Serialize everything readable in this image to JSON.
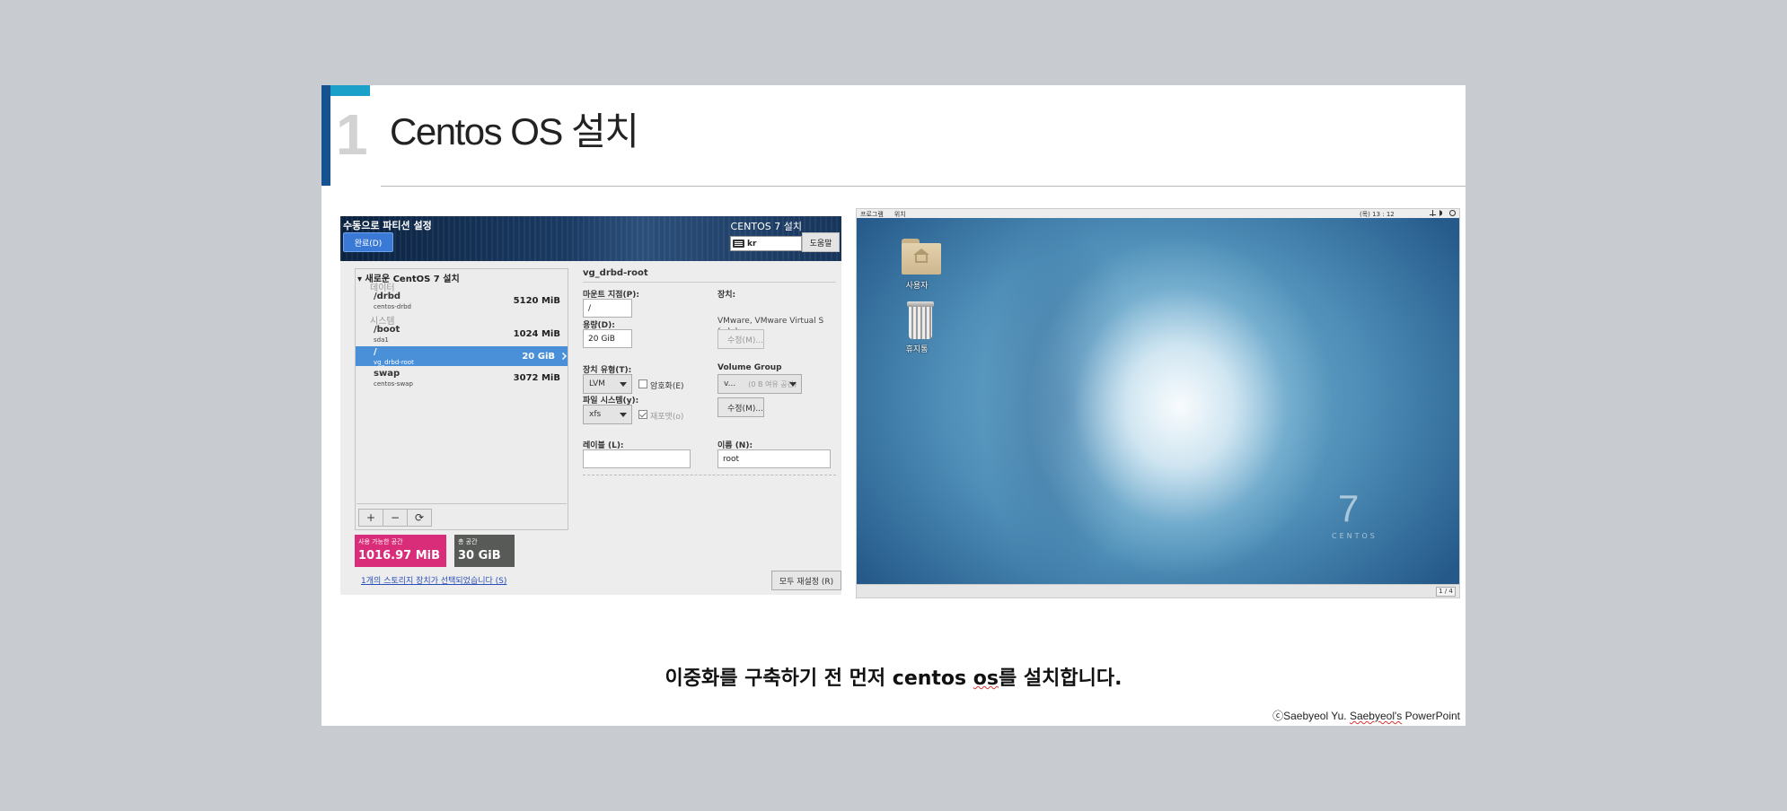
{
  "slide": {
    "number": "1",
    "title": "Centos  OS 설치",
    "caption_before": "이중화를 구축하기 전 먼저 centos ",
    "caption_os": "os",
    "caption_after": "를 설치합니다.",
    "credit_before": "ⓒSaebyeol Yu.  ",
    "credit_name": "Saebyeol's",
    "credit_after": " PowerPoint"
  },
  "partition": {
    "title": "수동으로 파티션 설정",
    "done_label": "완료(D)",
    "product": "CENTOS 7 설치",
    "keyboard": "kr",
    "help_label": "도움말",
    "tree_header": "새로운 CentOS 7 설치",
    "groups": [
      "데이터",
      "시스템"
    ],
    "items": [
      {
        "name": "/drbd",
        "device": "centos-drbd",
        "size": "5120 MiB"
      },
      {
        "name": "/boot",
        "device": "sda1",
        "size": "1024 MiB"
      },
      {
        "name": "/",
        "device": "vg_drbd-root",
        "size": "20 GiB"
      },
      {
        "name": "swap",
        "device": "centos-swap",
        "size": "3072 MiB"
      }
    ],
    "tools": [
      "+",
      "−",
      "⟳"
    ],
    "available_label": "사용 가능한 공간",
    "available_value": "1016.97 MiB",
    "total_label": "총 공간",
    "total_value": "30 GiB",
    "storage_link": "1개의 스토리지 장치가 선택되었습니다 (S)",
    "reset_label": "모두 재설정 (R)",
    "detail": {
      "title": "vg_drbd-root",
      "mount_label": "마운트 지점(P):",
      "mount_value": "/",
      "capacity_label": "용량(D):",
      "capacity_value": "20 GiB",
      "device_label": "장치:",
      "device_value": "VMware, VMware Virtual S (sda)",
      "modify_label": "수정(M)...",
      "device_type_label": "장치 유형(T):",
      "device_type_value": "LVM",
      "encrypt_label": "암호화(E)",
      "volume_group_label": "Volume Group",
      "volume_group_value": "v...",
      "volume_group_free": "(0 B 여유 공간)",
      "modify2_label": "수정(M)...",
      "filesystem_label": "파일 시스템(y):",
      "filesystem_value": "xfs",
      "reformat_label": "재포맷(o)",
      "label_label": "레이블 (L):",
      "label_value": "",
      "name_label": "이름 (N):",
      "name_value": "root"
    }
  },
  "desktop": {
    "menu_apps": "프로그램",
    "menu_places": "위치",
    "clock": "(목) 13 : 12",
    "icons": [
      {
        "label": "사용자",
        "icon": "home-folder-icon"
      },
      {
        "label": "휴지통",
        "icon": "trash-icon"
      }
    ],
    "logo_number": "7",
    "logo_text": "CENTOS",
    "workspace": "1 / 4"
  }
}
